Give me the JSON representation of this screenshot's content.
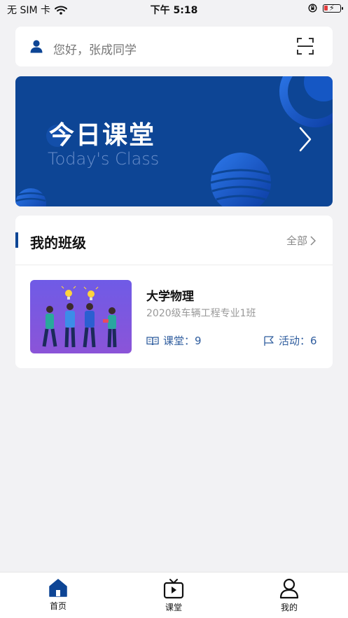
{
  "status_bar": {
    "carrier": "无 SIM 卡",
    "time": "下午 5:18"
  },
  "greeting": {
    "text": "您好，张成同学",
    "user_icon": "user-icon",
    "scan_icon": "scan-icon"
  },
  "banner": {
    "title": "今日课堂",
    "subtitle": "Today's Class",
    "accent": "#0d4595"
  },
  "my_class": {
    "section_title": "我的班级",
    "all_label": "全部",
    "course": {
      "name": "大学物理",
      "class_name": "2020级车辆工程专业1班",
      "lessons_label": "课堂：9",
      "activities_label": "活动：6"
    }
  },
  "tabbar": {
    "tabs": [
      {
        "label": "首页",
        "icon": "home-icon",
        "active": true
      },
      {
        "label": "课堂",
        "icon": "tv-play-icon",
        "active": false
      },
      {
        "label": "我的",
        "icon": "person-icon",
        "active": false
      }
    ]
  }
}
